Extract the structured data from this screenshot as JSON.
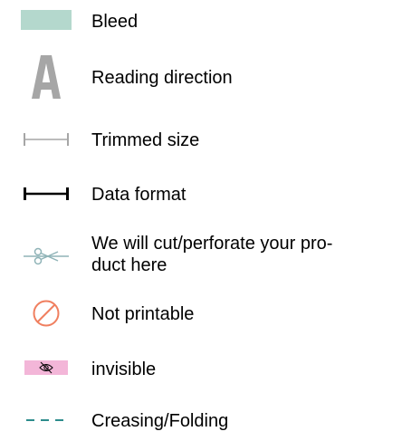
{
  "legend": {
    "items": [
      {
        "id": "bleed",
        "label": "Bleed",
        "icon": "bleed-swatch-icon"
      },
      {
        "id": "reading",
        "label": "Reading direction",
        "icon": "letter-a-icon"
      },
      {
        "id": "trim",
        "label": "Trimmed size",
        "icon": "trim-line-icon"
      },
      {
        "id": "data",
        "label": "Data format",
        "icon": "data-format-line-icon"
      },
      {
        "id": "cut",
        "label": "We will cut/perforate your pro-\nduct here",
        "icon": "scissors-icon"
      },
      {
        "id": "notprint",
        "label": "Not printable",
        "icon": "prohibited-icon"
      },
      {
        "id": "invisible",
        "label": "invisible",
        "icon": "eye-slash-icon"
      },
      {
        "id": "crease",
        "label": "Creasing/Folding",
        "icon": "dashed-line-icon"
      }
    ]
  },
  "icon_glyphs": {
    "reading_letter": "A"
  },
  "colors": {
    "bleed": "#b4d8cd",
    "reading": "#a6a6a6",
    "trim": "#a6a6a6",
    "data": "#000000",
    "cut": "#8fb3b7",
    "not_printable": "#f07f5f",
    "invisible_bg": "#f3b6d8",
    "invisible_eye": "#000000",
    "crease": "#2d8c8c"
  }
}
